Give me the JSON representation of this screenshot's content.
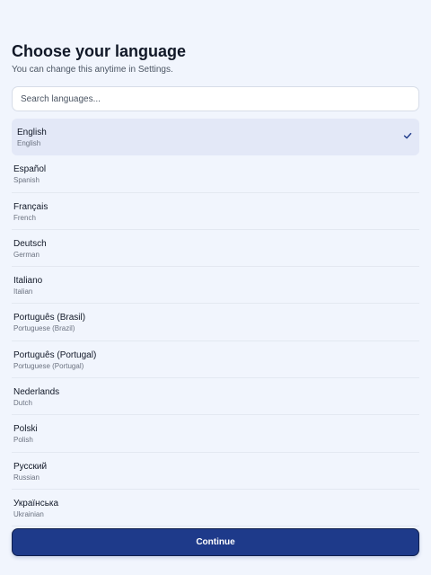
{
  "header": {
    "title": "Choose your language",
    "subtitle": "You can change this anytime in Settings."
  },
  "search": {
    "placeholder": "Search languages...",
    "value": ""
  },
  "languages": [
    {
      "native": "English",
      "english": "English",
      "selected": true
    },
    {
      "native": "Español",
      "english": "Spanish",
      "selected": false
    },
    {
      "native": "Français",
      "english": "French",
      "selected": false
    },
    {
      "native": "Deutsch",
      "english": "German",
      "selected": false
    },
    {
      "native": "Italiano",
      "english": "Italian",
      "selected": false
    },
    {
      "native": "Português (Brasil)",
      "english": "Portuguese (Brazil)",
      "selected": false
    },
    {
      "native": "Português (Portugal)",
      "english": "Portuguese (Portugal)",
      "selected": false
    },
    {
      "native": "Nederlands",
      "english": "Dutch",
      "selected": false
    },
    {
      "native": "Polski",
      "english": "Polish",
      "selected": false
    },
    {
      "native": "Русский",
      "english": "Russian",
      "selected": false
    },
    {
      "native": "Українська",
      "english": "Ukrainian",
      "selected": false
    }
  ],
  "selected_icon": "check-icon",
  "continue_label": "Continue",
  "colors": {
    "accent": "#1e3a8a",
    "selected_bg": "#e3e8f7",
    "background": "#f1f5fd"
  }
}
